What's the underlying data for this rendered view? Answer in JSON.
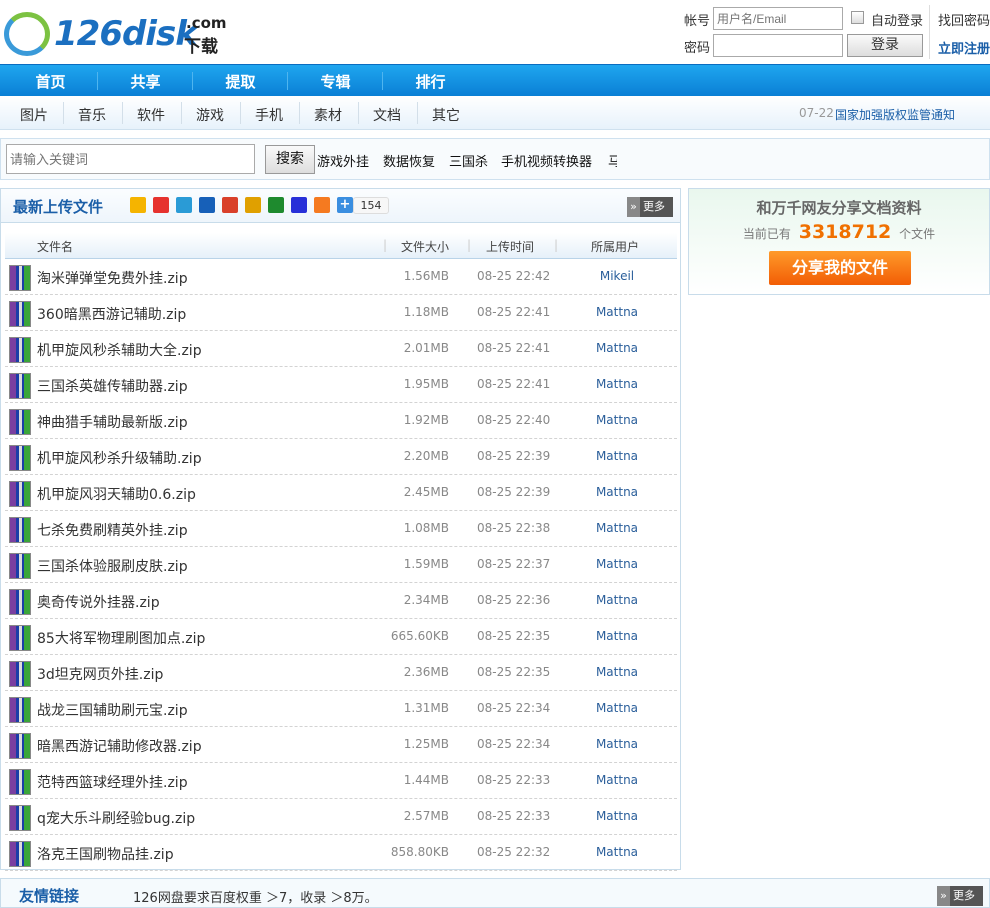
{
  "logo": {
    "text": "126disk",
    "com": ".com",
    "sub": "下载"
  },
  "login": {
    "account_label": "帐号",
    "account_placeholder": "用户名/Email",
    "password_label": "密码",
    "auto_login": "自动登录",
    "login_button": "登录",
    "forgot": "找回密码",
    "register": "立即注册"
  },
  "nav": [
    "首页",
    "共享",
    "提取",
    "专辑",
    "排行"
  ],
  "categories": [
    "图片",
    "音乐",
    "软件",
    "游戏",
    "手机",
    "素材",
    "文档",
    "其它"
  ],
  "notice": {
    "date": "07-22",
    "text": "国家加强版权监管通知"
  },
  "search": {
    "placeholder": "请输入关键词",
    "button": "搜索",
    "hot": [
      "游戏外挂",
      "数据恢复",
      "三国杀",
      "手机视频转换器",
      "马"
    ]
  },
  "latest": {
    "title": "最新上传文件",
    "share_count": "154",
    "more": "更多",
    "columns": [
      "文件名",
      "文件大小",
      "上传时间",
      "所属用户"
    ],
    "rows": [
      [
        "淘米弹弹堂免费外挂.zip",
        "1.56MB",
        "08-25 22:42",
        "Mikeil"
      ],
      [
        "360暗黑西游记辅助.zip",
        "1.18MB",
        "08-25 22:41",
        "Mattna"
      ],
      [
        "机甲旋风秒杀辅助大全.zip",
        "2.01MB",
        "08-25 22:41",
        "Mattna"
      ],
      [
        "三国杀英雄传辅助器.zip",
        "1.95MB",
        "08-25 22:41",
        "Mattna"
      ],
      [
        "神曲猎手辅助最新版.zip",
        "1.92MB",
        "08-25 22:40",
        "Mattna"
      ],
      [
        "机甲旋风秒杀升级辅助.zip",
        "2.20MB",
        "08-25 22:39",
        "Mattna"
      ],
      [
        "机甲旋风羽天辅助0.6.zip",
        "2.45MB",
        "08-25 22:39",
        "Mattna"
      ],
      [
        "七杀免费刷精英外挂.zip",
        "1.08MB",
        "08-25 22:38",
        "Mattna"
      ],
      [
        "三国杀体验服刷皮肤.zip",
        "1.59MB",
        "08-25 22:37",
        "Mattna"
      ],
      [
        "奥奇传说外挂器.zip",
        "2.34MB",
        "08-25 22:36",
        "Mattna"
      ],
      [
        "85大将军物理刷图加点.zip",
        "665.60KB",
        "08-25 22:35",
        "Mattna"
      ],
      [
        "3d坦克网页外挂.zip",
        "2.36MB",
        "08-25 22:35",
        "Mattna"
      ],
      [
        "战龙三国辅助刷元宝.zip",
        "1.31MB",
        "08-25 22:34",
        "Mattna"
      ],
      [
        "暗黑西游记辅助修改器.zip",
        "1.25MB",
        "08-25 22:34",
        "Mattna"
      ],
      [
        "范特西篮球经理外挂.zip",
        "1.44MB",
        "08-25 22:33",
        "Mattna"
      ],
      [
        "q宠大乐斗刷经验bug.zip",
        "2.57MB",
        "08-25 22:33",
        "Mattna"
      ],
      [
        "洛克王国刷物品挂.zip",
        "858.80KB",
        "08-25 22:32",
        "Mattna"
      ]
    ]
  },
  "side": {
    "title": "和万千网友分享文档资料",
    "prefix": "当前已有",
    "count": "3318712",
    "suffix": "个文件",
    "button": "分享我的文件"
  },
  "links": {
    "title": "友情链接",
    "text": "126网盘要求百度权重 ＞7，收录 ＞8万。",
    "more": "更多"
  }
}
